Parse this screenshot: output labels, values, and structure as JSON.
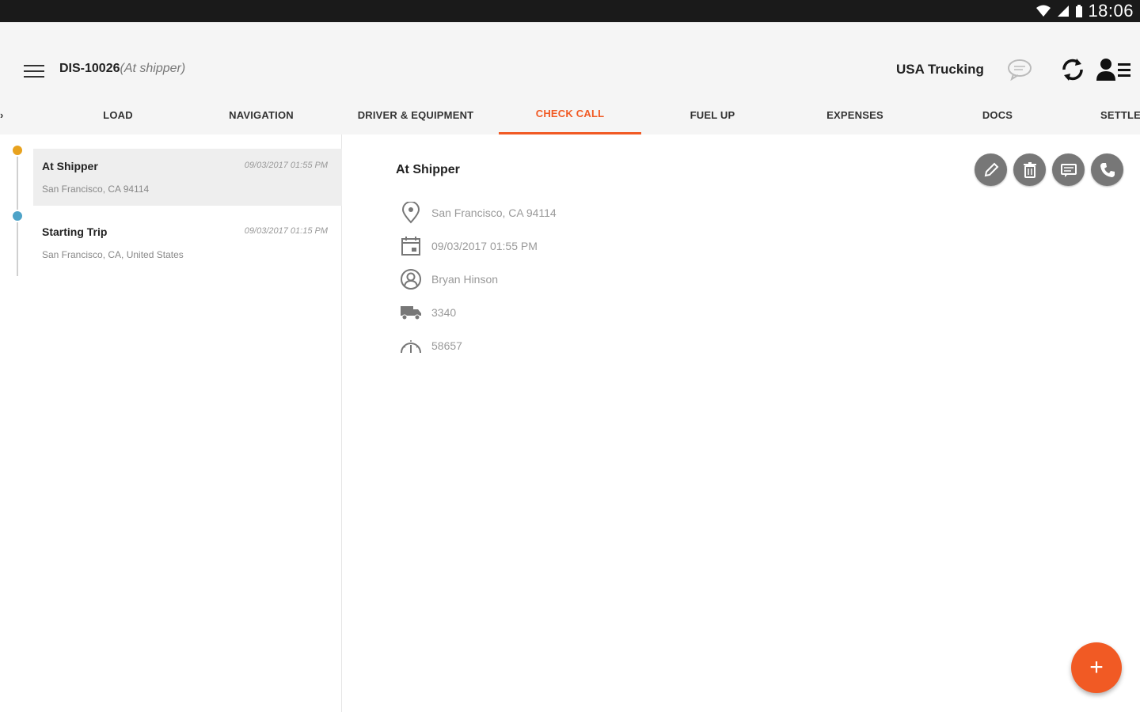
{
  "statusbar": {
    "time": "18:06"
  },
  "header": {
    "title": "DIS-10026",
    "title_status": "(At shipper)",
    "company": "USA Trucking"
  },
  "tabs": [
    {
      "label": "LOAD"
    },
    {
      "label": "NAVIGATION"
    },
    {
      "label": "DRIVER & EQUIPMENT"
    },
    {
      "label": "CHECK CALL"
    },
    {
      "label": "FUEL UP"
    },
    {
      "label": "EXPENSES"
    },
    {
      "label": "DOCS"
    },
    {
      "label": "SETTLE"
    }
  ],
  "checkcalls": [
    {
      "title": "At Shipper",
      "time": "09/03/2017 01:55 PM",
      "location": "San Francisco, CA 94114"
    },
    {
      "title": "Starting Trip",
      "time": "09/03/2017 01:15 PM",
      "location": "San Francisco, CA, United States"
    }
  ],
  "detail": {
    "title": "At Shipper",
    "location": "San Francisco, CA 94114",
    "datetime": "09/03/2017 01:55 PM",
    "driver": "Bryan Hinson",
    "truck": "3340",
    "odometer": "58657"
  },
  "fab": {
    "label": "+"
  },
  "colors": {
    "accent": "#f15a24",
    "dot_orange": "#e8a21e",
    "dot_blue": "#4ea3c8",
    "action_gray": "#777777"
  },
  "icons": [
    "menu-icon",
    "chat-icon",
    "sync-icon",
    "user-list-icon",
    "edit-icon",
    "delete-icon",
    "message-icon",
    "phone-icon",
    "location-pin-icon",
    "calendar-icon",
    "person-icon",
    "truck-icon",
    "gauge-icon"
  ]
}
